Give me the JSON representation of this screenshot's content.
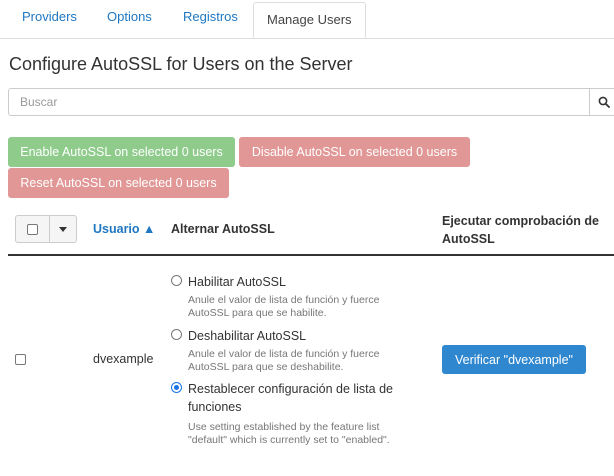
{
  "tabs": [
    {
      "label": "Providers"
    },
    {
      "label": "Options"
    },
    {
      "label": "Registros"
    },
    {
      "label": "Manage Users",
      "active": true
    }
  ],
  "page_title": "Configure AutoSSL for Users on the Server",
  "search": {
    "placeholder": "Buscar",
    "value": "",
    "icon": "search-icon"
  },
  "actions": {
    "enable_label": "Enable AutoSSL on selected 0 users",
    "disable_label": "Disable AutoSSL on selected 0 users",
    "reset_label": "Reset AutoSSL on selected 0 users",
    "enable_color": "#8fcc8c",
    "disable_color": "#e19796"
  },
  "table": {
    "headers": {
      "user": "Usuario ▲",
      "toggle": "Alternar AutoSSL",
      "check_line1": "Ejecutar comprobación de",
      "check_line2": "AutoSSL"
    },
    "rows": [
      {
        "selected": false,
        "username": "dvexample",
        "options": [
          {
            "label": "Habilitar AutoSSL",
            "help_line1": "Anule el valor de lista de función y fuerce",
            "help_line2": "AutoSSL para que se habilite.",
            "checked": false
          },
          {
            "label": "Deshabilitar AutoSSL",
            "help_line1": "Anule el valor de lista de función y fuerce",
            "help_line2": "AutoSSL para que se deshabilite.",
            "checked": false
          },
          {
            "label_line1": "Restablecer configuración de lista de",
            "label_line2": "funciones",
            "help_line1": "Use setting established by the feature list",
            "help_line2": "\"default\" which is currently set to \"enabled\".",
            "checked": true
          }
        ],
        "verify_label": "Verificar \"dvexample\""
      }
    ]
  },
  "colors": {
    "accent": "#1f77c1",
    "verify_button": "#2f87d0",
    "radio_checked": "#1a73e8"
  }
}
